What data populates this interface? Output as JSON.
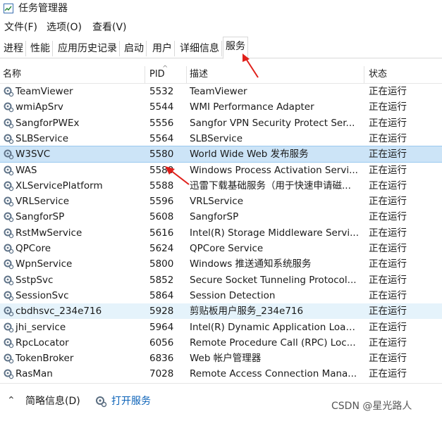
{
  "window": {
    "title": "任务管理器"
  },
  "menu": [
    {
      "label": "文件(F)"
    },
    {
      "label": "选项(O)"
    },
    {
      "label": "查看(V)"
    }
  ],
  "tabs": [
    {
      "label": "进程"
    },
    {
      "label": "性能"
    },
    {
      "label": "应用历史记录"
    },
    {
      "label": "启动"
    },
    {
      "label": "用户"
    },
    {
      "label": "详细信息"
    },
    {
      "label": "服务",
      "active": true
    }
  ],
  "columns": {
    "name": "名称",
    "pid": "PID",
    "desc": "描述",
    "status": "状态"
  },
  "services": [
    {
      "name": "TeamViewer",
      "pid": "5532",
      "desc": "TeamViewer",
      "status": "正在运行"
    },
    {
      "name": "wmiApSrv",
      "pid": "5544",
      "desc": "WMI Performance Adapter",
      "status": "正在运行"
    },
    {
      "name": "SangforPWEx",
      "pid": "5556",
      "desc": "Sangfor VPN Security Protect Ser...",
      "status": "正在运行"
    },
    {
      "name": "SLBService",
      "pid": "5564",
      "desc": "SLBService",
      "status": "正在运行"
    },
    {
      "name": "W3SVC",
      "pid": "5580",
      "desc": "World Wide Web 发布服务",
      "status": "正在运行",
      "selected": true
    },
    {
      "name": "WAS",
      "pid": "5580",
      "desc": "Windows Process Activation Servi...",
      "status": "正在运行"
    },
    {
      "name": "XLServicePlatform",
      "pid": "5588",
      "desc": "迅雷下载基础服务（用于快速申请磁...",
      "status": "正在运行"
    },
    {
      "name": "VRLService",
      "pid": "5596",
      "desc": "VRLService",
      "status": "正在运行"
    },
    {
      "name": "SangforSP",
      "pid": "5608",
      "desc": "SangforSP",
      "status": "正在运行"
    },
    {
      "name": "RstMwService",
      "pid": "5616",
      "desc": "Intel(R) Storage Middleware Servi...",
      "status": "正在运行"
    },
    {
      "name": "QPCore",
      "pid": "5624",
      "desc": "QPCore Service",
      "status": "正在运行"
    },
    {
      "name": "WpnService",
      "pid": "5800",
      "desc": "Windows 推送通知系统服务",
      "status": "正在运行"
    },
    {
      "name": "SstpSvc",
      "pid": "5852",
      "desc": "Secure Socket Tunneling Protocol...",
      "status": "正在运行"
    },
    {
      "name": "SessionSvc",
      "pid": "5864",
      "desc": "Session Detection",
      "status": "正在运行"
    },
    {
      "name": "cbdhsvc_234e716",
      "pid": "5928",
      "desc": "剪贴板用户服务_234e716",
      "status": "正在运行",
      "hover": true
    },
    {
      "name": "jhi_service",
      "pid": "5964",
      "desc": "Intel(R) Dynamic Application Load...",
      "status": "正在运行"
    },
    {
      "name": "RpcLocator",
      "pid": "6056",
      "desc": "Remote Procedure Call (RPC) Loc...",
      "status": "正在运行"
    },
    {
      "name": "TokenBroker",
      "pid": "6836",
      "desc": "Web 帐户管理器",
      "status": "正在运行"
    },
    {
      "name": "RasMan",
      "pid": "7028",
      "desc": "Remote Access Connection Mana...",
      "status": "正在运行"
    }
  ],
  "footer": {
    "less_label": "简略信息(D)",
    "open_services": "打开服务"
  },
  "watermark": "CSDN @星光路人",
  "colors": {
    "accent": "#0b62b8",
    "annotation": "#e0201b",
    "selected_bg": "#cce4f7"
  }
}
